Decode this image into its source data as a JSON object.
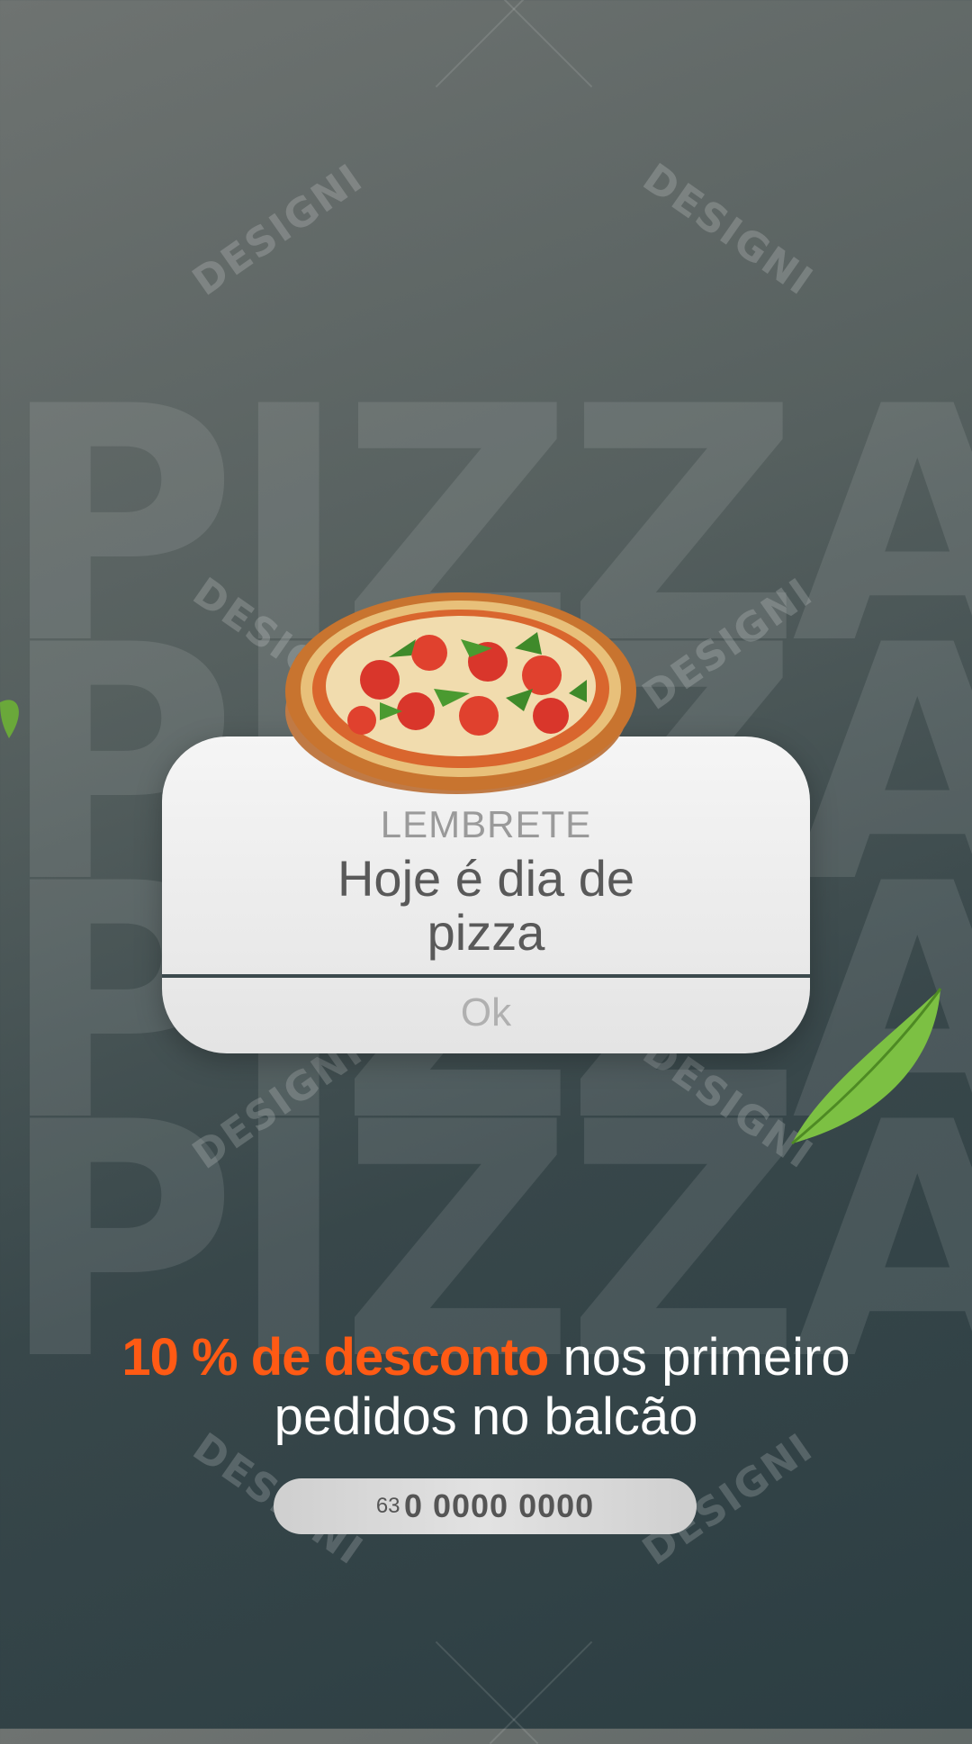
{
  "background": {
    "words": [
      "PIZZA",
      "PIZZA",
      "PIZZA",
      "PIZZA"
    ],
    "watermark": "DESIGNI"
  },
  "dialog": {
    "label": "LEMBRETE",
    "message": "Hoje é dia de pizza",
    "button": "Ok"
  },
  "promo": {
    "highlight": "10 % de desconto",
    "line1_rest": " nos primeiro",
    "line2": "pedidos no balcão"
  },
  "phone": {
    "area_code": "63",
    "number": "0 0000 0000"
  },
  "colors": {
    "accent": "#ff5a14",
    "dialog_bg": "#ececec",
    "background_dark": "#2c3e43"
  }
}
